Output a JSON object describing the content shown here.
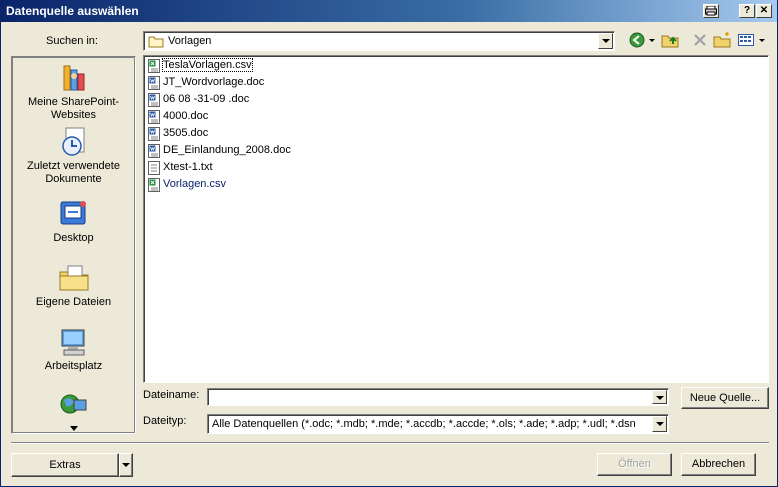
{
  "window": {
    "title": "Datenquelle auswählen"
  },
  "lookin": {
    "label": "Suchen in:",
    "value": "Vorlagen"
  },
  "places": [
    {
      "label": "Meine SharePoint-Websites"
    },
    {
      "label": "Zuletzt verwendete Dokumente"
    },
    {
      "label": "Desktop"
    },
    {
      "label": "Eigene Dateien"
    },
    {
      "label": "Arbeitsplatz"
    }
  ],
  "files": [
    {
      "name": "TeslaVorlagen.csv",
      "type": "csv"
    },
    {
      "name": "JT_Wordvorlage.doc",
      "type": "doc"
    },
    {
      "name": "06 08 -31-09 .doc",
      "type": "doc"
    },
    {
      "name": "4000.doc",
      "type": "doc"
    },
    {
      "name": "3505.doc",
      "type": "doc"
    },
    {
      "name": "DE_Einlandung_2008.doc",
      "type": "doc"
    },
    {
      "name": "Xtest-1.txt",
      "type": "txt"
    },
    {
      "name": "Vorlagen.csv",
      "type": "csv"
    }
  ],
  "filename": {
    "label": "Dateiname:",
    "value": ""
  },
  "filetype": {
    "label": "Dateityp:",
    "value": "Alle Datenquellen (*.odc; *.mdb; *.mde; *.accdb; *.accde; *.ols; *.ade; *.adp; *.udl; *.dsn"
  },
  "buttons": {
    "new_source": "Neue Quelle...",
    "tools": "Extras",
    "open": "Öffnen",
    "cancel": "Abbrechen"
  },
  "colors": {
    "titlebar": "#0a246a",
    "csv_link": "#0a246a"
  }
}
